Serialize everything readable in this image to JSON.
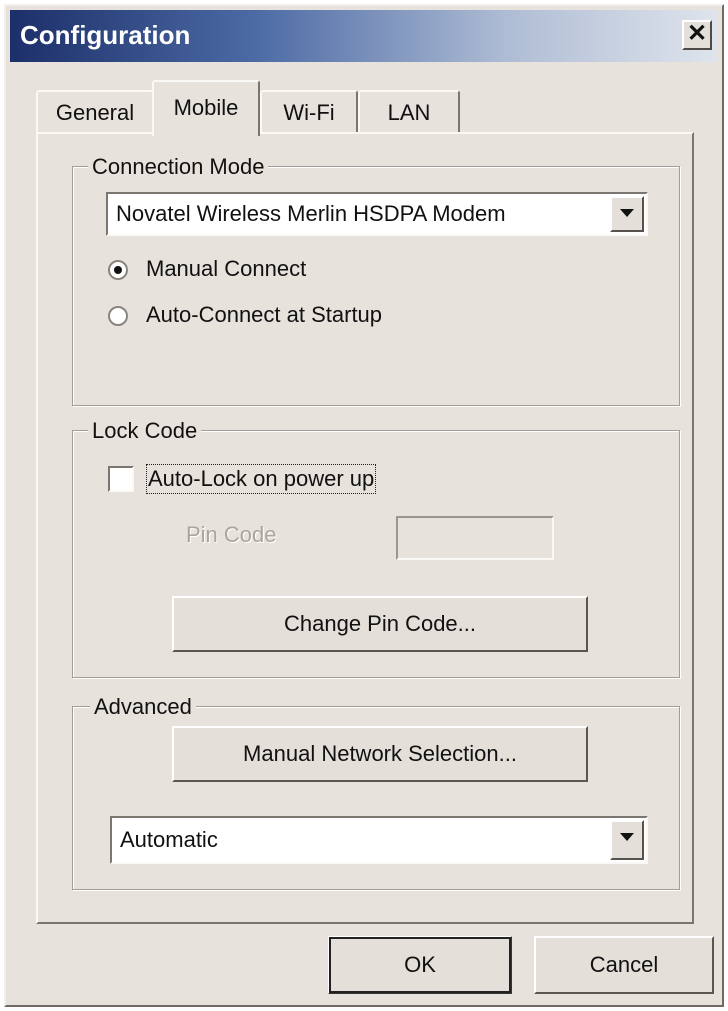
{
  "window": {
    "title": "Configuration",
    "close_symbol": "✕"
  },
  "tabs": [
    {
      "label": "General",
      "active": false
    },
    {
      "label": "Mobile",
      "active": true
    },
    {
      "label": "Wi-Fi",
      "active": false
    },
    {
      "label": "LAN",
      "active": false
    }
  ],
  "connection_mode": {
    "group_label": "Connection Mode",
    "device_selected": "Novatel Wireless Merlin HSDPA Modem",
    "radio_options": [
      {
        "label": "Manual Connect",
        "checked": true
      },
      {
        "label": "Auto-Connect at Startup",
        "checked": false
      }
    ]
  },
  "lock_code": {
    "group_label": "Lock Code",
    "auto_lock_label": "Auto-Lock on power up",
    "auto_lock_checked": false,
    "pin_label": "Pin Code",
    "pin_value": "",
    "change_pin_button": "Change Pin Code..."
  },
  "advanced": {
    "group_label": "Advanced",
    "network_selection_button": "Manual Network Selection...",
    "network_mode_selected": "Automatic"
  },
  "footer": {
    "ok_label": "OK",
    "cancel_label": "Cancel"
  },
  "icons": {
    "dropdown_arrow": "chevron-down-icon",
    "close": "close-icon"
  }
}
